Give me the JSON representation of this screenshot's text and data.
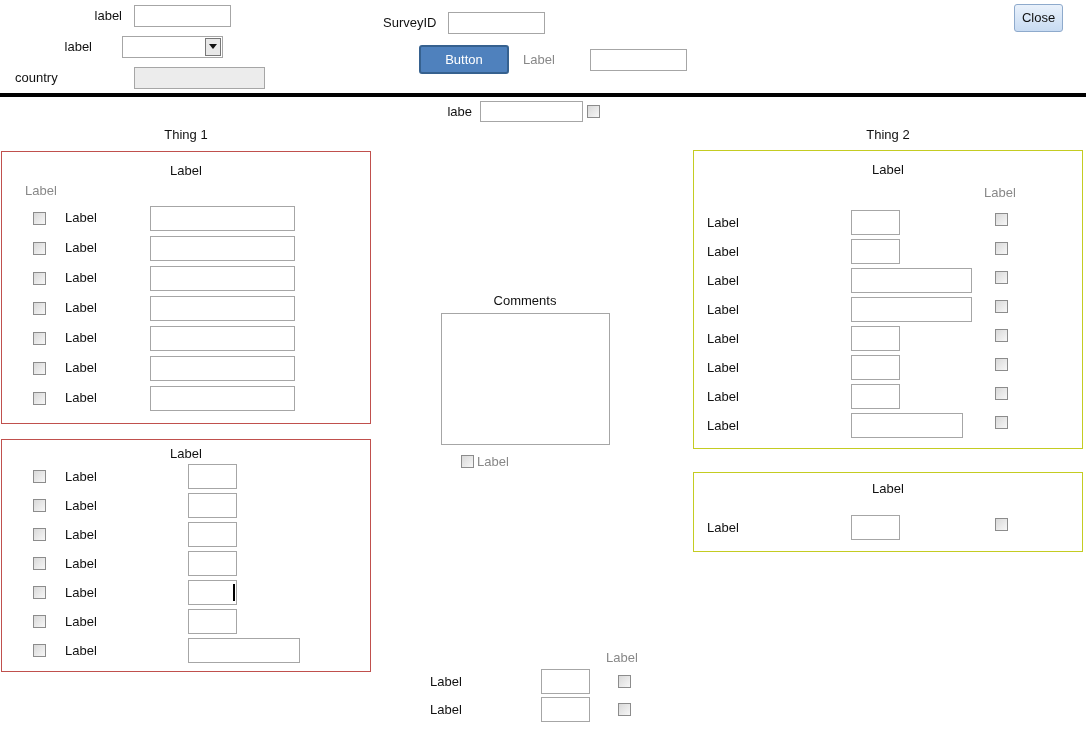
{
  "header": {
    "fields": [
      {
        "label": "label",
        "kind": "text"
      },
      {
        "label": "label",
        "kind": "dropdown"
      },
      {
        "label": "country",
        "kind": "disabled"
      }
    ],
    "survey_id": {
      "label": "SurveyID"
    },
    "button": "Button",
    "side_label": "Label",
    "close": "Close"
  },
  "top_check": {
    "label": "labe",
    "checked": false
  },
  "left": {
    "title": "Thing 1",
    "panels": [
      {
        "title": "Label",
        "column_header": "Label",
        "rows": [
          {
            "label": "Label",
            "checked": false,
            "kind": "long",
            "focused": false
          },
          {
            "label": "Label",
            "checked": false,
            "kind": "long",
            "focused": false
          },
          {
            "label": "Label",
            "checked": false,
            "kind": "long",
            "focused": false
          },
          {
            "label": "Label",
            "checked": false,
            "kind": "long",
            "focused": false
          },
          {
            "label": "Label",
            "checked": false,
            "kind": "long",
            "focused": false
          },
          {
            "label": "Label",
            "checked": false,
            "kind": "long",
            "focused": false
          },
          {
            "label": "Label",
            "checked": false,
            "kind": "long",
            "focused": false
          }
        ]
      },
      {
        "title": "Label",
        "rows": [
          {
            "label": "Label",
            "checked": false,
            "kind": "short",
            "focused": false
          },
          {
            "label": "Label",
            "checked": false,
            "kind": "short",
            "focused": false
          },
          {
            "label": "Label",
            "checked": false,
            "kind": "short",
            "focused": false
          },
          {
            "label": "Label",
            "checked": false,
            "kind": "short",
            "focused": false
          },
          {
            "label": "Label",
            "checked": false,
            "kind": "short",
            "focused": true
          },
          {
            "label": "Label",
            "checked": false,
            "kind": "short",
            "focused": false
          },
          {
            "label": "Label",
            "checked": false,
            "kind": "medium",
            "focused": false
          }
        ]
      }
    ]
  },
  "comments": {
    "title": "Comments",
    "checkbox": {
      "label": "Label",
      "checked": false
    }
  },
  "center_bottom": {
    "column_header": "Label",
    "rows": [
      {
        "label": "Label",
        "checked": false
      },
      {
        "label": "Label",
        "checked": false
      }
    ]
  },
  "right": {
    "title": "Thing 2",
    "panels": [
      {
        "title": "Label",
        "column_header": "Label",
        "rows": [
          {
            "label": "Label",
            "kind": "short",
            "checked": false
          },
          {
            "label": "Label",
            "kind": "short",
            "checked": false
          },
          {
            "label": "Label",
            "kind": "wide",
            "checked": false
          },
          {
            "label": "Label",
            "kind": "wide",
            "checked": false
          },
          {
            "label": "Label",
            "kind": "short",
            "checked": false
          },
          {
            "label": "Label",
            "kind": "short",
            "checked": false
          },
          {
            "label": "Label",
            "kind": "short",
            "checked": false
          },
          {
            "label": "Label",
            "kind": "medium",
            "checked": false
          }
        ]
      },
      {
        "title": "Label",
        "rows": [
          {
            "label": "Label",
            "kind": "short",
            "checked": false
          }
        ]
      }
    ]
  }
}
